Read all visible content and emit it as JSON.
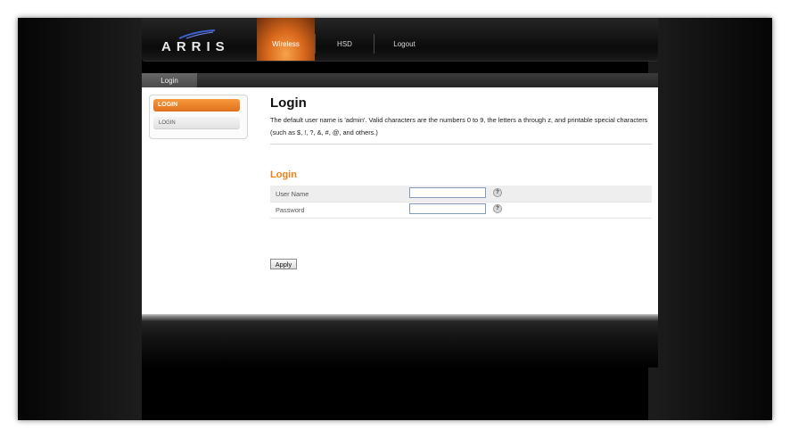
{
  "header": {
    "logo": "ARRIS",
    "nav": [
      {
        "label": "Wireless",
        "active": true
      },
      {
        "label": "HSD",
        "active": false
      },
      {
        "label": "Logout",
        "active": false
      }
    ]
  },
  "tabstrip": {
    "active_tab": "Login"
  },
  "subnav": {
    "active_label": "LOGIN",
    "items": [
      {
        "label": "LOGIN"
      }
    ]
  },
  "main": {
    "title": "Login",
    "description": "The default user name is 'admin'. Valid characters are the numbers 0 to 9, the letters a through z, and printable special characters (such as $, !, ?, &, #, @, and others.)",
    "section_title": "Login",
    "fields": [
      {
        "label": "User Name",
        "value": "",
        "type": "text"
      },
      {
        "label": "Password",
        "value": "",
        "type": "password"
      }
    ],
    "help_glyph": "?",
    "apply_label": "Apply"
  },
  "colors": {
    "accent": "#ef7f1a",
    "nav_active": "#d9681c",
    "background": "#000000"
  },
  "icons": {
    "help": "question-mark-icon",
    "logo_mark": "arris-swoosh-icon"
  }
}
